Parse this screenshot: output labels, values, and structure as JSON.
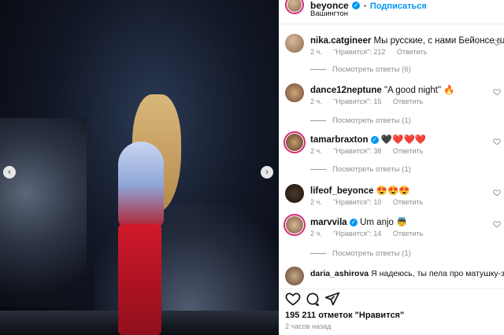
{
  "post": {
    "username": "beyonce",
    "follow_label": "Подписаться",
    "location": "Вашингтон",
    "likes_label": "195 211 отметок \"Нравится\"",
    "time_label": "2 часов назад"
  },
  "comments": [
    {
      "user": "nika.catgineer",
      "text": "Мы русские, с нами Бейонсе ruruRU",
      "time": "2 ч.",
      "likes": "\"Нравится\": 212",
      "reply": "Ответить",
      "replies": "Посмотреть ответы (6)"
    },
    {
      "user": "dance12neptune",
      "text": "\"A good night\" 🔥",
      "time": "2 ч.",
      "likes": "\"Нравится\": 15",
      "reply": "Ответить",
      "replies": "Посмотреть ответы (1)"
    },
    {
      "user": "tamarbraxton",
      "text": "🖤❤️❤️❤️",
      "time": "2 ч.",
      "likes": "\"Нравится\": 38",
      "reply": "Ответить",
      "replies": "Посмотреть ответы (1)"
    },
    {
      "user": "lifeof_beyonce",
      "text": "😍😍😍",
      "time": "2 ч.",
      "likes": "\"Нравится\": 10",
      "reply": "Ответить",
      "replies": ""
    },
    {
      "user": "marvvila",
      "text": "Um anjo 👼",
      "time": "2 ч.",
      "likes": "\"Нравится\": 14",
      "reply": "Ответить",
      "replies": "Посмотреть ответы (1)"
    },
    {
      "user": "daria_ashirova",
      "text": "Я надеюсь, ты пела про матушку-землю ❤️",
      "time": "",
      "likes": "",
      "reply": "",
      "replies": ""
    }
  ],
  "icons": [
    "heart-icon",
    "comment-icon",
    "share-icon",
    "chevron-left-icon",
    "chevron-right-icon",
    "verified-icon"
  ]
}
